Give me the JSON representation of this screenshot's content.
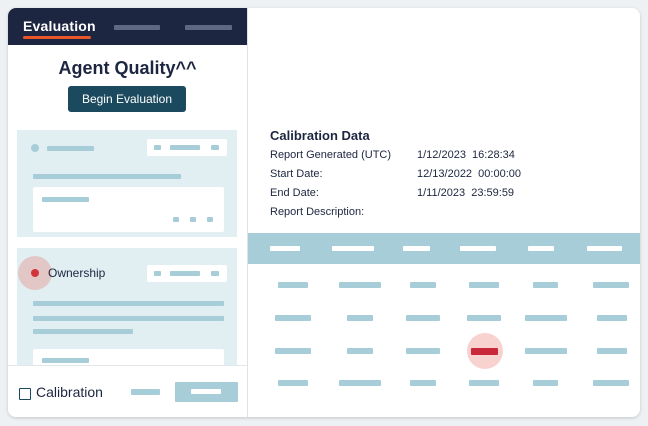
{
  "header": {
    "active_tab": "Evaluation"
  },
  "panel": {
    "title": "Agent Quality^^",
    "begin_button": "Begin Evaluation"
  },
  "ownership_card": {
    "label": "Ownership"
  },
  "calibration_toggle": {
    "label": "Calibration"
  },
  "calibration_data": {
    "title": "Calibration Data",
    "rows": [
      {
        "label": "Report Generated (UTC)",
        "value": "1/12/2023  16:28:34"
      },
      {
        "label": "Start Date:",
        "value": "12/13/2022  00:00:00"
      },
      {
        "label": "End Date:",
        "value": "1/11/2023  23:59:59"
      },
      {
        "label": "Report Description:",
        "value": ""
      }
    ]
  },
  "colors": {
    "header_bg": "#1d2640",
    "accent": "#e8562a",
    "button_bg": "#1b4a5e",
    "placeholder": "#a7cdd8",
    "card_bg": "#e1eff2",
    "highlight_red": "#c8283a"
  }
}
